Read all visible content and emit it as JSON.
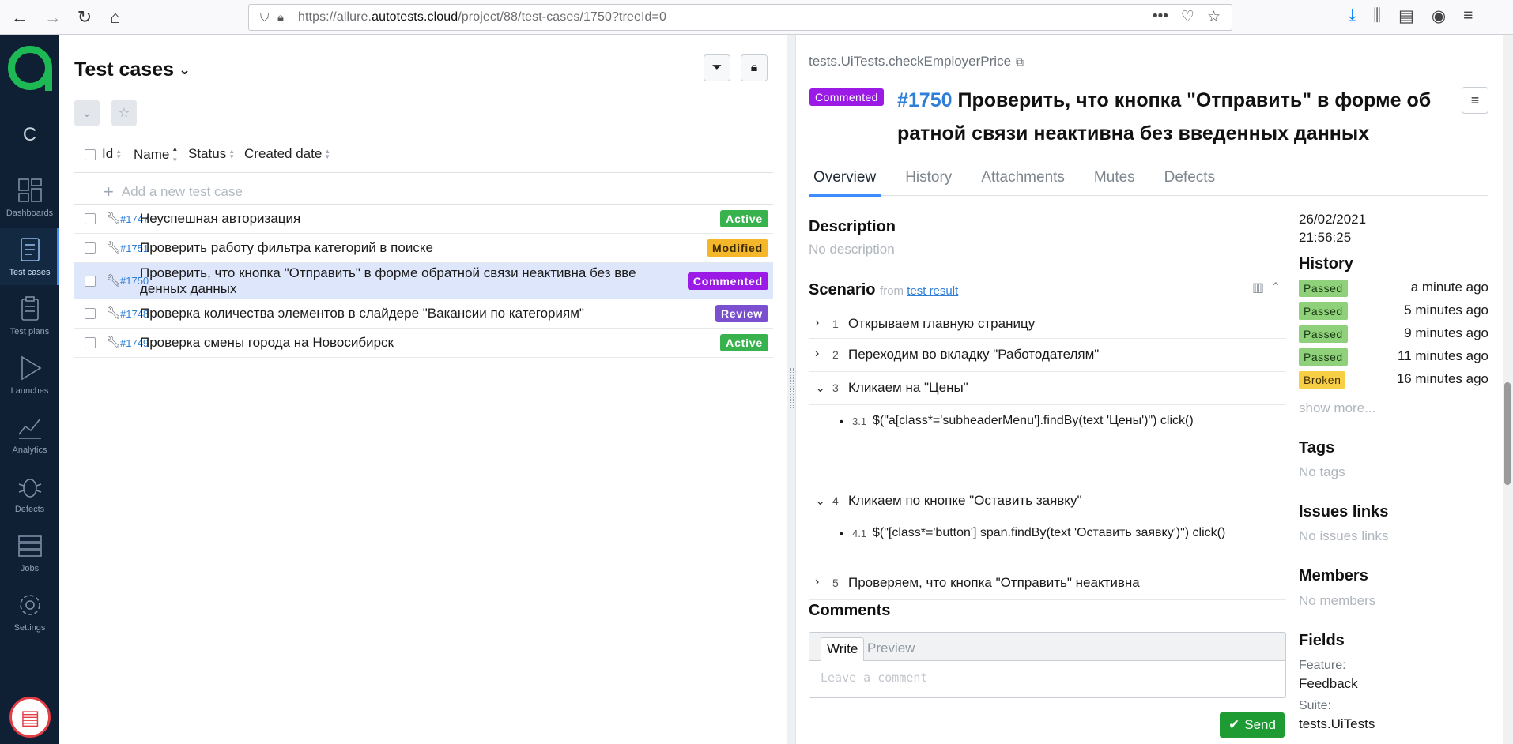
{
  "browser": {
    "url_prefix": "https://allure.",
    "url_domain": "autotests.cloud",
    "url_path": "/project/88/test-cases/1750?treeId=0"
  },
  "nav": {
    "items": [
      {
        "label": "Dashboards",
        "icon": "dashboards-icon"
      },
      {
        "label": "Test cases",
        "icon": "test-cases-icon"
      },
      {
        "label": "Test plans",
        "icon": "test-plans-icon"
      },
      {
        "label": "Launches",
        "icon": "launches-icon"
      },
      {
        "label": "Analytics",
        "icon": "analytics-icon"
      },
      {
        "label": "Defects",
        "icon": "defects-icon"
      },
      {
        "label": "Jobs",
        "icon": "jobs-icon"
      },
      {
        "label": "Settings",
        "icon": "settings-icon"
      }
    ],
    "collapse_label": "C"
  },
  "list": {
    "title": "Test cases",
    "columns": [
      "Id",
      "Name",
      "Status",
      "Created date"
    ],
    "add_placeholder": "Add a new test case",
    "rows": [
      {
        "id": "#1747",
        "name": "Неуспешная авторизация",
        "status": "Active"
      },
      {
        "id": "#1751",
        "name": "Проверить работу фильтра категорий в поиске",
        "status": "Modified"
      },
      {
        "id": "#1750",
        "name": "Проверить, что кнопка \"Отправить\" в форме обратной связи неактивна без вве",
        "name2": "денных данных",
        "status": "Commented"
      },
      {
        "id": "#1748",
        "name": "Проверка количества элементов в слайдере \"Вакансии по категориям\"",
        "status": "Review"
      },
      {
        "id": "#1749",
        "name": "Проверка смены города на Новосибирск",
        "status": "Active"
      }
    ]
  },
  "detail": {
    "path": "tests.UiTests.checkEmployerPrice",
    "status": "Commented",
    "id": "#1750",
    "title_line1": "Проверить, что кнопка \"Отправить\" в форме об",
    "title_line2": "ратной связи неактивна без введенных данных",
    "tabs": [
      "Overview",
      "History",
      "Attachments",
      "Mutes",
      "Defects"
    ],
    "description_label": "Description",
    "description_value": "No description",
    "scenario_label": "Scenario",
    "scenario_from": "from",
    "scenario_link": "test result",
    "steps": [
      {
        "n": "1",
        "text": "Открываем главную страницу"
      },
      {
        "n": "2",
        "text": "Переходим во вкладку \"Работодателям\""
      },
      {
        "n": "3",
        "text": "Кликаем на \"Цены\""
      },
      {
        "n": "3.1",
        "text": "$(\"a[class*='subheaderMenu'].findBy(text 'Цены')\") click()"
      },
      {
        "n": "4",
        "text": "Кликаем по кнопке \"Оставить заявку\""
      },
      {
        "n": "4.1",
        "text": "$(\"[class*='button'] span.findBy(text 'Оставить заявку')\") click()"
      },
      {
        "n": "5",
        "text": "Проверяем, что кнопка \"Отправить\" неактивна"
      }
    ],
    "comments_label": "Comments",
    "comment_tab_write": "Write",
    "comment_tab_preview": "Preview",
    "comment_placeholder": "Leave a comment",
    "send_label": "Send"
  },
  "info": {
    "date": "26/02/2021",
    "time": "21:56:25",
    "history_label": "History",
    "history": [
      {
        "status": "Passed",
        "time": "a minute ago"
      },
      {
        "status": "Passed",
        "time": "5 minutes ago"
      },
      {
        "status": "Passed",
        "time": "9 minutes ago"
      },
      {
        "status": "Passed",
        "time": "11 minutes ago"
      },
      {
        "status": "Broken",
        "time": "16 minutes ago"
      }
    ],
    "show_more": "show more...",
    "tags_label": "Tags",
    "tags_value": "No tags",
    "issues_label": "Issues links",
    "issues_value": "No issues links",
    "members_label": "Members",
    "members_value": "No members",
    "fields_label": "Fields",
    "feature_label": "Feature:",
    "feature_value": "Feedback",
    "suite_label": "Suite:",
    "suite_value": "tests.UiTests"
  },
  "colors": {
    "brand_green": "#1db954",
    "nav_bg": "#0f1f34",
    "link_blue": "#2f7fd9",
    "commented": "#9b1ae6"
  }
}
